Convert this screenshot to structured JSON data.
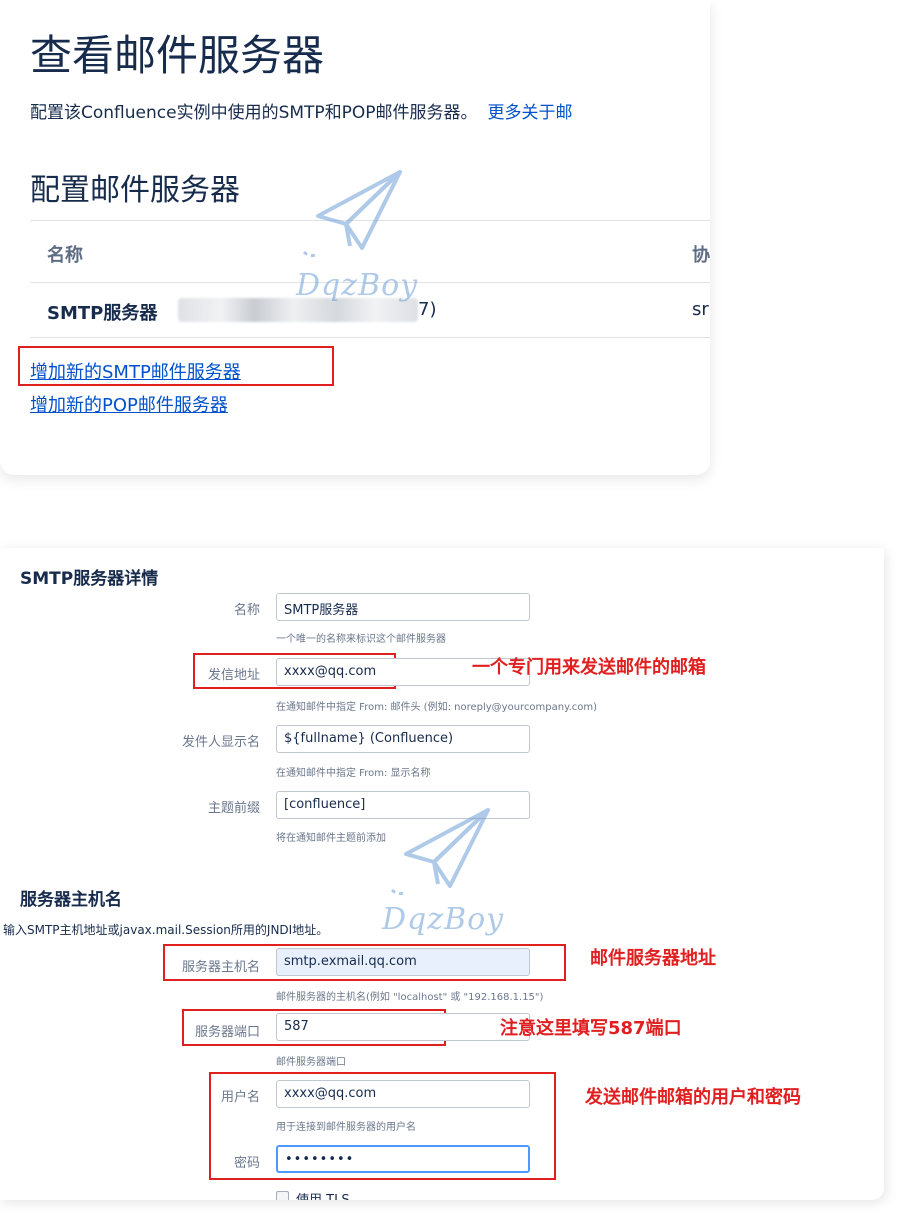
{
  "view_servers": {
    "title": "查看邮件服务器",
    "description": "配置该Confluence实例中使用的SMTP和POP邮件服务器。",
    "more_link": "更多关于邮",
    "section_title": "配置邮件服务器",
    "table": {
      "columns": [
        "名称",
        "协"
      ],
      "rows": [
        {
          "name": "SMTP服务器",
          "server_tail": "7)",
          "protocol": "sr"
        }
      ]
    },
    "links": {
      "add_smtp": "增加新的SMTP邮件服务器",
      "add_pop": "增加新的POP邮件服务器"
    }
  },
  "smtp_details": {
    "title": "SMTP服务器详情",
    "name": {
      "label": "名称",
      "value": "SMTP服务器",
      "help": "一个唯一的名称来标识这个邮件服务器"
    },
    "from_address": {
      "label": "发信地址",
      "value": "xxxx@qq.com",
      "help": "在通知邮件中指定 From: 邮件头 (例如: noreply@yourcompany.com)"
    },
    "from_name": {
      "label": "发件人显示名",
      "value": "${fullname} (Confluence)",
      "help": "在通知邮件中指定 From: 显示名称"
    },
    "subject_prefix": {
      "label": "主题前缀",
      "value": "[confluence]",
      "help": "将在通知邮件主题前添加"
    }
  },
  "hostname_section": {
    "title": "服务器主机名",
    "description": "输入SMTP主机地址或javax.mail.Session所用的JNDI地址。",
    "host": {
      "label": "服务器主机名",
      "value": "smtp.exmail.qq.com",
      "help": "邮件服务器的主机名(例如 \"localhost\" 或 \"192.168.1.15\")"
    },
    "port": {
      "label": "服务器端口",
      "value": "587",
      "help": "邮件服务器端口"
    },
    "username": {
      "label": "用户名",
      "value": "xxxx@qq.com",
      "help": "用于连接到邮件服务器的用户名"
    },
    "password": {
      "label": "密码",
      "value": "••••••••"
    },
    "tls_label": "使用 TLS"
  },
  "annotations": {
    "from_address_note": "一个专门用来发送邮件的邮箱",
    "host_note": "邮件服务器地址",
    "port_note": "注意这里填写587端口",
    "credentials_note": "发送邮件邮箱的用户和密码"
  },
  "watermark": "DqzBoy",
  "colors": {
    "link": "#0052cc",
    "annotation": "#e02020",
    "watermark": "#6f9fd8",
    "autofill": "#e8f0fe"
  }
}
